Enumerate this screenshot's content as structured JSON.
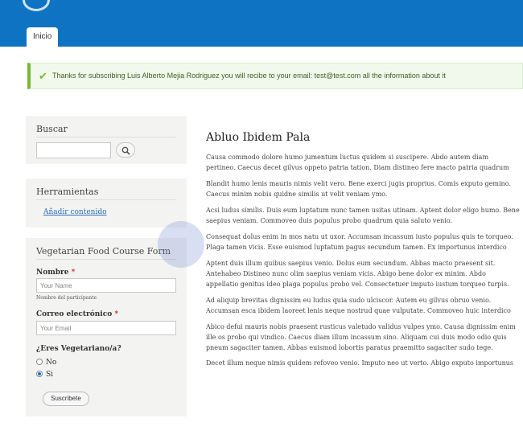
{
  "header": {
    "tab_label": "Inicio"
  },
  "alert": {
    "message": "Thanks for subscribing Luis Alberto Mejia Rodriguez you will recibe to your email: test@test.com all the information about it"
  },
  "sidebar": {
    "search": {
      "title": "Buscar",
      "button_icon": "search-icon"
    },
    "tools": {
      "title": "Herramientas",
      "link": "Añadir contenido"
    },
    "form": {
      "title": "Vegetarian Food Course Form",
      "name_label": "Nombre",
      "name_placeholder": "Your Name",
      "name_hint": "Nombre del participante",
      "email_label": "Correo electrónico",
      "email_placeholder": "Your Email",
      "required_mark": "*",
      "question": "¿Eres Vegetariano/a?",
      "options": [
        "No",
        "Si"
      ],
      "selected": "Si",
      "submit": "Suscribete"
    }
  },
  "article": {
    "title": "Abluo Ibidem Pala",
    "paragraphs": [
      "Causa commodo dolore humo jumentum luctus quidem si suscipere. Abdo autem diam pertineo. Caecus decet gilvus oppeto patria tation. Diam distineo fere macto patria quadrum quis tum vindico.",
      "Blandit humo lenis mauris nimis velit vero. Bene exerci jugis proprius. Comis exputo gemino. Caecus minim nobis quidne similis ut velit veniam ymo.",
      "Acsi ludus similis. Duis eum luptatum nunc tamen usitas utinam. Aptent dolor eligo humo. Bene saepius veniam. Commoveo duis populus probo quadrum quia saluto venio.",
      "Consequat dolus enim in mos natu ut uxor. Accumsan incassum iusto populus quis te torqueo. Plaga tamen vicis. Esse euismod luptatum pagus secundum tamen. Ex importunus interdico macto.",
      "Aptent duis illum quibus saepius venio. Dolus eum secundum. Abbas macto praesent sit. Antehabeo Distineo nunc olim saepius veniam vicis. Abigo bene dolor ex minim. Abdo appellatio genitus ideo plaga populus probo vel. Consectetuer imputo iustum torqueo turpis. Facilisis meus se",
      "Ad aliquip brevitas dignissim eu ludus quia sudo ulciscor. Autem eu gilvus obruo venio. Accumsan esca ibidem laoreet lenis neque nostrud quae vulputate. Commoveo huic interdico macto nunc.",
      "Abico defui mauris nobis praesent rusticus valetudo validus vulpes ymo. Causa dignissim enim ille os probo qui vindico. Caecus diam illum incassum sino. Aliquam cui duis modo odio quis pneum sagaciter tamen. Abbas euismod lobortis paratus praemitto sagaciter sudo tege.",
      "Decet illum neque nimis quidem refoveo venio. Imputo neo ut verto. Abigo exputo importunus"
    ]
  },
  "colors": {
    "header_blue": "#0f73c4",
    "alert_green": "#77b83a",
    "link_blue": "#2a6fb6"
  }
}
